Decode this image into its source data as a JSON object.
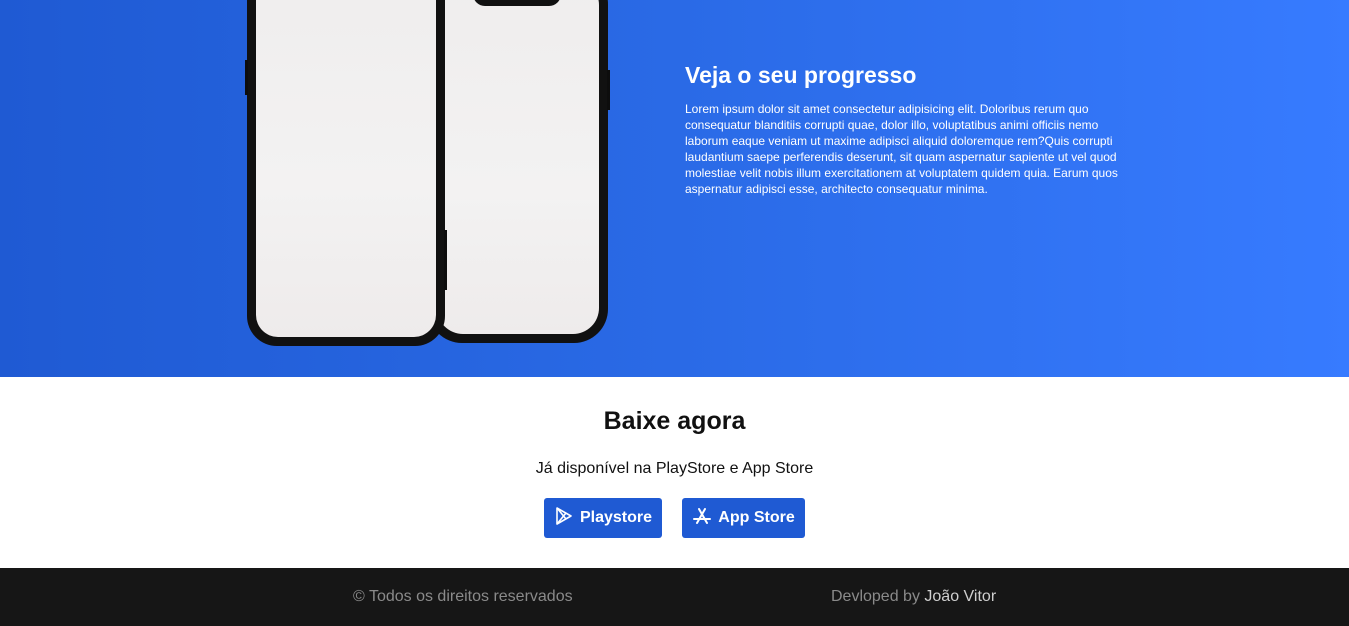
{
  "hero": {
    "title": "Veja o seu progresso",
    "text": "Lorem ipsum dolor sit amet consectetur adipisicing elit. Doloribus rerum quo consequatur blanditiis corrupti quae, dolor illo, voluptatibus animi officiis nemo laborum eaque veniam ut maxime adipisci aliquid doloremque rem?Quis corrupti laudantium saepe perferendis deserunt, sit quam aspernatur sapiente ut vel quod molestiae velit nobis illum exercitationem at voluptatem quidem quia. Earum quos aspernatur adipisci esse, architecto consequatur minima."
  },
  "download": {
    "title": "Baixe agora",
    "subtitle": "Já disponível na PlayStore e App Store",
    "playstore_label": "Playstore",
    "appstore_label": "App Store"
  },
  "footer": {
    "copyright": "© Todos os direitos reservados",
    "developed_by": "Devloped by",
    "author": "João Vitor"
  },
  "colors": {
    "accent": "#1f5ad3",
    "gradient_end": "#377bff",
    "footer_bg": "#161616"
  }
}
